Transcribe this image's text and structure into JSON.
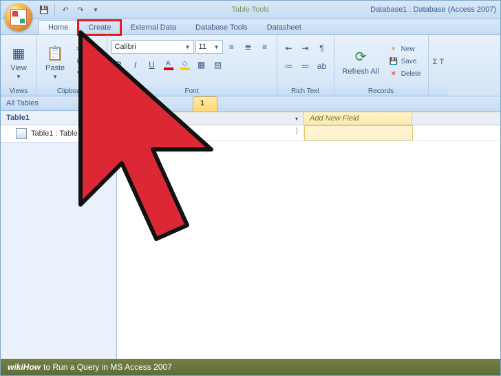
{
  "titlebar": {
    "contextual": "Table Tools",
    "title": "Database1 : Database (Access 2007)"
  },
  "tabs": [
    "Home",
    "Create",
    "External Data",
    "Database Tools",
    "Datasheet"
  ],
  "ribbon": {
    "views": {
      "view": "View",
      "label": "Views"
    },
    "clipboard": {
      "paste": "Paste",
      "cut": "Cut",
      "copy": "Cop",
      "format": "For",
      "label": "Clipboard"
    },
    "font": {
      "name": "Calibri",
      "size": "11",
      "label": "Font"
    },
    "richtext": {
      "label": "Rich Text"
    },
    "records": {
      "refresh": "Refresh All",
      "new": "New",
      "save": "Save",
      "delete": "Delete",
      "label": "Records"
    },
    "sigma": "Σ T"
  },
  "nav": {
    "header": "All Tables",
    "group": "Table1",
    "item": "Table1 : Table"
  },
  "docTab": "1",
  "datasheet": {
    "addNew": "Add New Field"
  },
  "footer": {
    "brand": "wikiHow",
    "text": " to Run a Query in MS Access 2007"
  }
}
